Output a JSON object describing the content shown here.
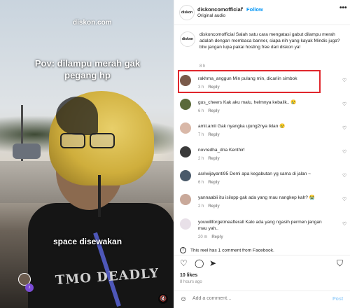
{
  "media": {
    "watermark": "diskon.com",
    "caption_top": "Pov: dilampu merah gak pegang hp",
    "caption_bottom": "space disewakan",
    "shirt_text": "TMO DEADLY"
  },
  "header": {
    "avatar_text": "diskon",
    "username": "diskoncomofficial",
    "separator": "•",
    "follow": "Follow",
    "audio": "Original audio",
    "more_icon": "more-horizontal-icon"
  },
  "caption": {
    "avatar_text": "diskon",
    "text": "diskoncomofficial Salah satu cara mengatasi gabut dilampu merah adalah dengan membaca banner, siapa nih yang kayak Mindis juga?\nbtw jangan lupa pakai hosting free dari diskon ya!",
    "time": "8 h"
  },
  "comments": [
    {
      "user": "rakhma_anggun",
      "text": "Min pulang min, dicariin simbok",
      "time": "3 h",
      "reply": "Reply",
      "avatar_color": "#7a5a4a"
    },
    {
      "user": "gus_cheers",
      "text": "Kak aku malu, helmnya kebalik.. 😢",
      "time": "6 h",
      "reply": "Reply",
      "avatar_color": "#5a6a3a"
    },
    {
      "user": "amii.amii",
      "text": "Gak nyangka ujung2nya iklan 😢",
      "time": "7 h",
      "reply": "Reply",
      "avatar_color": "#d9b8a8"
    },
    {
      "user": "novredha_dna",
      "text": "Kenthir!",
      "time": "2 h",
      "reply": "Reply",
      "avatar_color": "#3a3a3a"
    },
    {
      "user": "asriwijayanti95",
      "text": "Demi apa kegabutan yg sama di jalan ~",
      "time": "6 h",
      "reply": "Reply",
      "avatar_color": "#4a5a6a"
    },
    {
      "user": "yannaabii",
      "text": "itu isilopp gak ada yang mau nangkep kah? 😭",
      "time": "2 h",
      "reply": "Reply",
      "avatar_color": "#c9a99a"
    },
    {
      "user": "youwillforgetmeafterall",
      "text": "Kalo ada yang ngasih permen jangan mau yah..",
      "time": "20 m",
      "reply": "Reply",
      "avatar_color": "#e8e0e8"
    }
  ],
  "fb_note": "This reel has 1 comment from Facebook.",
  "actions": {
    "like_icon": "heart-icon",
    "comment_icon": "comment-icon",
    "share_icon": "send-icon",
    "save_icon": "bookmark-icon"
  },
  "likes": "10 likes",
  "time_ago": "8 hours ago",
  "add_comment": {
    "placeholder": "Add a comment…",
    "post": "Post"
  }
}
